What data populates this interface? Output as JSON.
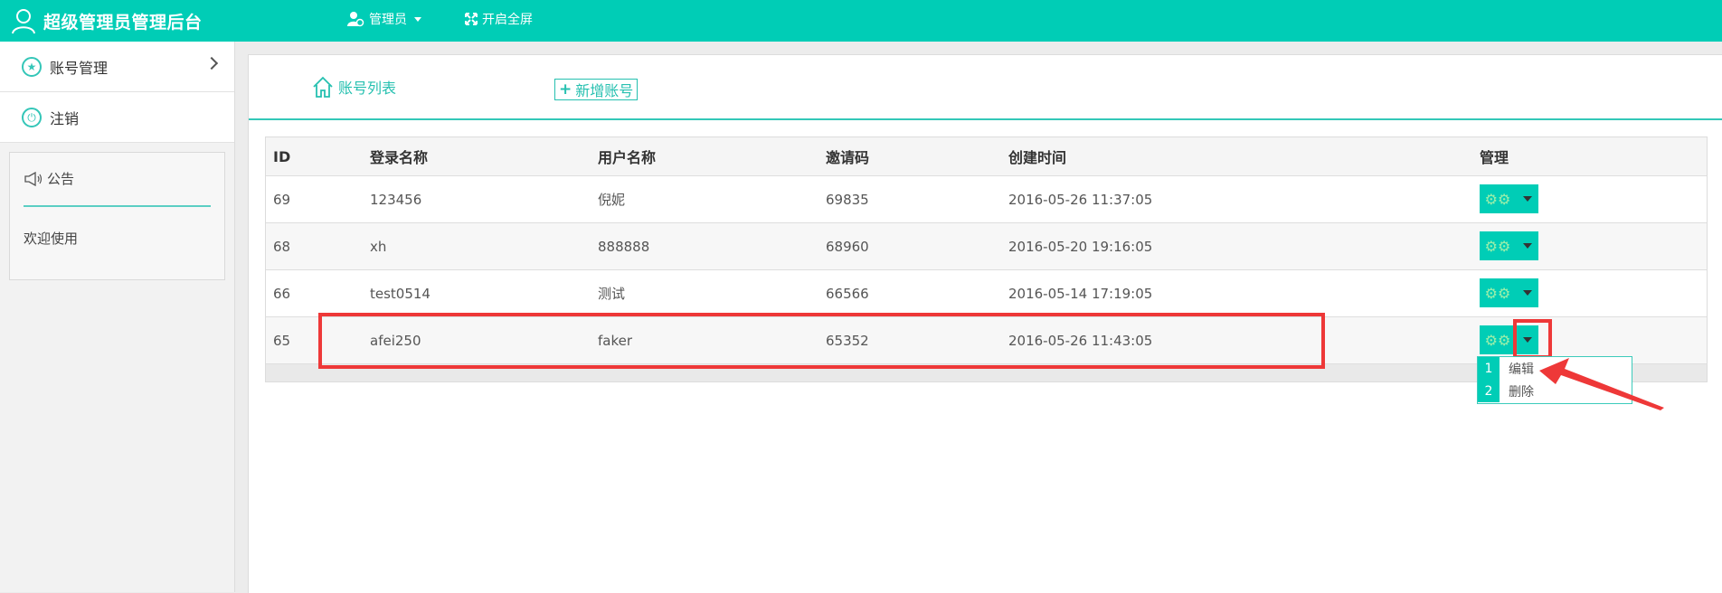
{
  "header": {
    "title": "超级管理员管理后台",
    "user_menu_label": "管理员",
    "fullscreen_label": "开启全屏"
  },
  "sidebar": {
    "items": [
      {
        "label": "账号管理",
        "icon": "star-icon"
      },
      {
        "label": "注销",
        "icon": "power-icon"
      }
    ],
    "notice": {
      "title": "公告",
      "text": "欢迎使用"
    }
  },
  "tabs": {
    "list_label": "账号列表",
    "add_label": "新增账号"
  },
  "table": {
    "columns": [
      "ID",
      "登录名称",
      "用户名称",
      "邀请码",
      "创建时间",
      "管理"
    ],
    "rows": [
      [
        "69",
        "123456",
        "倪妮",
        "69835",
        "2016-05-26 11:37:05"
      ],
      [
        "68",
        "xh",
        "888888",
        "68960",
        "2016-05-20 19:16:05"
      ],
      [
        "66",
        "test0514",
        "测试",
        "66566",
        "2016-05-14 17:19:05"
      ],
      [
        "65",
        "afei250",
        "faker",
        "65352",
        "2016-05-26 11:43:05"
      ]
    ]
  },
  "dropdown": {
    "items": [
      {
        "num": "1",
        "label": "编辑"
      },
      {
        "num": "2",
        "label": "删除"
      }
    ]
  },
  "colors": {
    "accent": "#00cdb6",
    "highlight": "#ee3838"
  }
}
